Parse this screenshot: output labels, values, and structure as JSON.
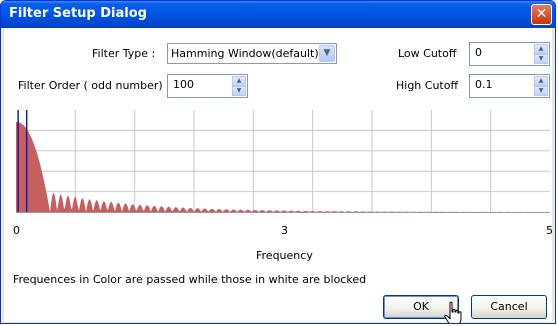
{
  "window": {
    "title": "Filter Setup Dialog",
    "close_glyph": "✕"
  },
  "form": {
    "filter_type_label": "Filter Type :",
    "filter_type_value": "Hamming Window(default)",
    "filter_order_label": "Filter Order ( odd number)",
    "filter_order_value": "100",
    "low_cutoff_label": "Low Cutoff",
    "low_cutoff_value": "0",
    "high_cutoff_label": "High Cutoff",
    "high_cutoff_value": "0.1"
  },
  "chart_data": {
    "type": "area",
    "xlabel": "Frequency",
    "x_ticks": [
      "0",
      "3",
      "5"
    ],
    "xlim": [
      0,
      5
    ],
    "grid": true,
    "fill_color": "#c66060",
    "cutoff_lines": [
      0.02,
      0.1
    ],
    "cutoff_color": "#1b1b9e"
  },
  "note": "Frequences in Color are passed while those in white are blocked",
  "buttons": {
    "ok": "OK",
    "cancel": "Cancel"
  },
  "colors": {
    "title_bar": "#0054e3",
    "border": "#0831d9"
  }
}
